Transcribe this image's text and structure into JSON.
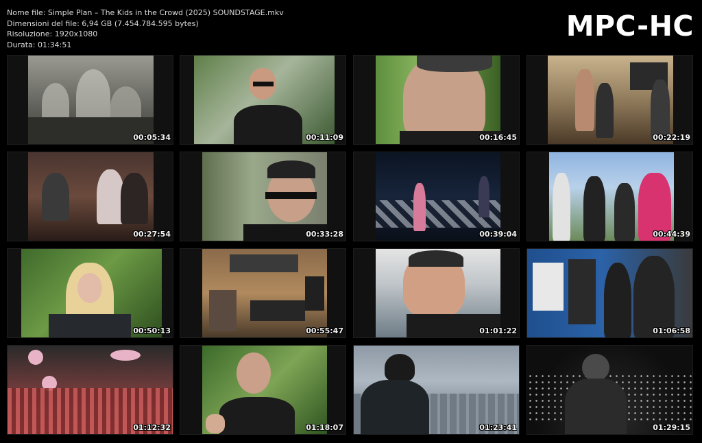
{
  "file_info": {
    "name_line": "Nome file: Simple Plan – The Kids in the Crowd (2025) SOUNDSTAGE.mkv",
    "size_line": "Dimensioni del file: 6,94 GB (7.454.784.595 bytes)",
    "resolution_line": "Risoluzione: 1920x1080",
    "duration_line": "Durata: 01:34:51"
  },
  "logo": "MPC-HC",
  "thumbnails": [
    {
      "time": "00:05:34",
      "scene": "crowd-black-and-white"
    },
    {
      "time": "00:11:09",
      "scene": "interview-man-glasses-outdoors"
    },
    {
      "time": "00:16:45",
      "scene": "closeup-man-face-park"
    },
    {
      "time": "00:22:19",
      "scene": "band-rehearsal-room"
    },
    {
      "time": "00:27:54",
      "scene": "band-backstage-dark"
    },
    {
      "time": "00:33:28",
      "scene": "interview-man-spiky-hair"
    },
    {
      "time": "00:39:04",
      "scene": "stage-performance-checkered-floor"
    },
    {
      "time": "00:44:39",
      "scene": "band-outdoors-sunny"
    },
    {
      "time": "00:50:13",
      "scene": "interview-blonde-woman"
    },
    {
      "time": "00:55:47",
      "scene": "recording-studio-console"
    },
    {
      "time": "01:01:22",
      "scene": "closeup-man-tent"
    },
    {
      "time": "01:06:58",
      "scene": "backstage-blue-room"
    },
    {
      "time": "01:12:32",
      "scene": "stadium-crowd-balloons"
    },
    {
      "time": "01:18:07",
      "scene": "interview-man-garden"
    },
    {
      "time": "01:23:41",
      "scene": "man-overlooking-city"
    },
    {
      "time": "01:29:15",
      "scene": "singer-facing-crowd-lights"
    }
  ]
}
